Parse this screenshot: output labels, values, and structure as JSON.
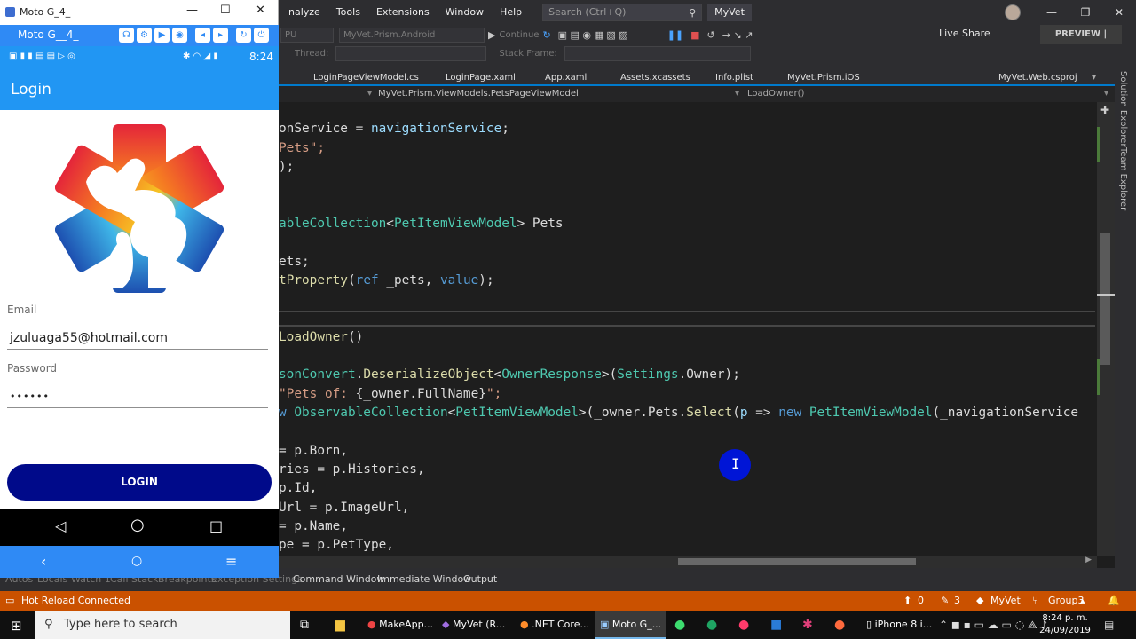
{
  "vs": {
    "menu": [
      "nalyze",
      "Tools",
      "Extensions",
      "Window",
      "Help"
    ],
    "search_placeholder": "Search (Ctrl+Q)",
    "solution_name": "MyVet",
    "toolbar": {
      "platform": "PU",
      "startup_project": "MyVet.Prism.Android",
      "continue": "Continue",
      "thread_label": "Thread:",
      "stack_frame_label": "Stack Frame:",
      "live_share": "Live Share",
      "preview_admin": "PREVIEW | ADMIN"
    },
    "tabs": [
      "LoginPageViewModel.cs",
      "LoginPage.xaml",
      "App.xaml",
      "Assets.xcassets",
      "Info.plist",
      "MyVet.Prism.iOS",
      "MyVet.Web.csproj"
    ],
    "nav": {
      "class_path": "MyVet.Prism.ViewModels.PetsPageViewModel",
      "member": "LoadOwner()"
    },
    "side_panels": [
      "Solution Explorer",
      "Team Explorer"
    ],
    "tool_tabs": [
      "Autos",
      "Locals",
      "Watch 1",
      "Call Stack",
      "Breakpoints",
      "Exception Settings",
      "Command Window",
      "Immediate Window",
      "Output"
    ],
    "status": {
      "message": "Hot Reload Connected",
      "up_count": "0",
      "edit_count": "3",
      "repo": "MyVet",
      "branch": "Group3"
    }
  },
  "code": {
    "l1": [
      "onService = ",
      "navigationService",
      ";"
    ],
    "l2": [
      "Pets\";"
    ],
    "l3": [
      ");"
    ],
    "l4": [
      "ableCollection",
      "<",
      "PetItemViewModel",
      "> Pets"
    ],
    "l5": [
      "ets;"
    ],
    "l6": [
      "tProperty",
      "(",
      "ref",
      " _pets, ",
      "value",
      ");"
    ],
    "l7": [
      "LoadOwner",
      "()"
    ],
    "l8": [
      "sonConvert",
      ".",
      "DeserializeObject",
      "<",
      "OwnerResponse",
      ">(",
      "Settings",
      ".Owner);"
    ],
    "l9": [
      "\"Pets of: ",
      "{_owner.FullName}",
      "\";"
    ],
    "l10": [
      "w ",
      "ObservableCollection",
      "<",
      "PetItemViewModel",
      ">(_owner.Pets.",
      "Select",
      "(",
      "p",
      " => ",
      "new",
      " ",
      "PetItemViewModel",
      "(_navigationService"
    ],
    "l11": [
      "= p.Born,"
    ],
    "l12": [
      "ries = p.Histories,"
    ],
    "l13": [
      "p.Id,"
    ],
    "l14": [
      "Url = p.ImageUrl,"
    ],
    "l15": [
      "= p.Name,"
    ],
    "l16": [
      "pe = p.PetType,"
    ]
  },
  "emulator": {
    "window_title": "Moto G_4_",
    "device_name": "Moto G__4_",
    "status_time": "8:24",
    "app_title": "Login",
    "email_label": "Email",
    "email_value": "jzuluaga55@hotmail.com",
    "password_label": "Password",
    "password_value": "••••••",
    "login_button": "LOGIN"
  },
  "taskbar": {
    "search_placeholder": "Type here to search",
    "apps": [
      "MakeApp...",
      "MyVet (R...",
      ".NET Core...",
      "Moto G_...",
      "iPhone 8 i..."
    ],
    "clock_time": "8:24 p. m.",
    "clock_date": "24/09/2019"
  },
  "colors": {
    "vs_status": "#ca5100",
    "android_primary": "#2196f3",
    "login_button": "#000a8a"
  }
}
